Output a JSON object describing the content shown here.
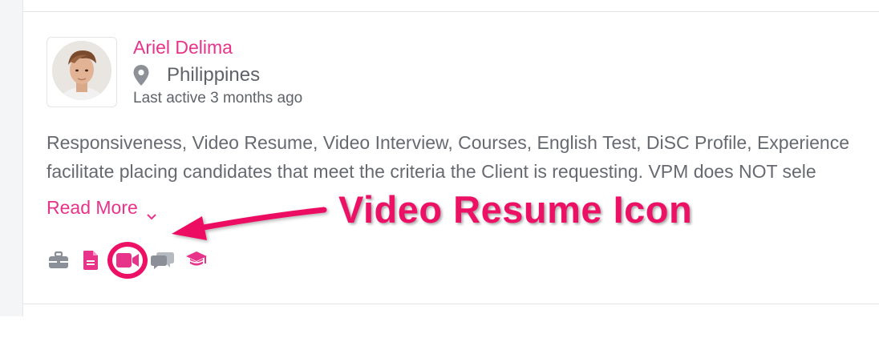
{
  "profile": {
    "name": "Ariel Delima",
    "location": "Philippines",
    "last_active": "Last active 3 months ago"
  },
  "description": {
    "line1": "Responsiveness, Video Resume, Video Interview, Courses, English Test, DiSC Profile, Experience",
    "line2": "facilitate placing candidates that meet the criteria the Client is requesting. VPM does NOT sele"
  },
  "read_more": {
    "label": "Read More"
  },
  "badges": [
    {
      "icon": "briefcase-icon",
      "color": "#8a8f98"
    },
    {
      "icon": "document-icon",
      "color": "#e8338a"
    },
    {
      "icon": "video-camera-icon",
      "color": "#e8338a"
    },
    {
      "icon": "chat-bubbles-icon",
      "color": "#8a8f98"
    },
    {
      "icon": "graduation-cap-icon",
      "color": "#e8338a"
    }
  ],
  "annotation": {
    "text": "Video Resume Icon",
    "color": "#ec1164"
  },
  "colors": {
    "accent": "#e8338a",
    "text": "#666a70",
    "annotation": "#ec1164"
  }
}
